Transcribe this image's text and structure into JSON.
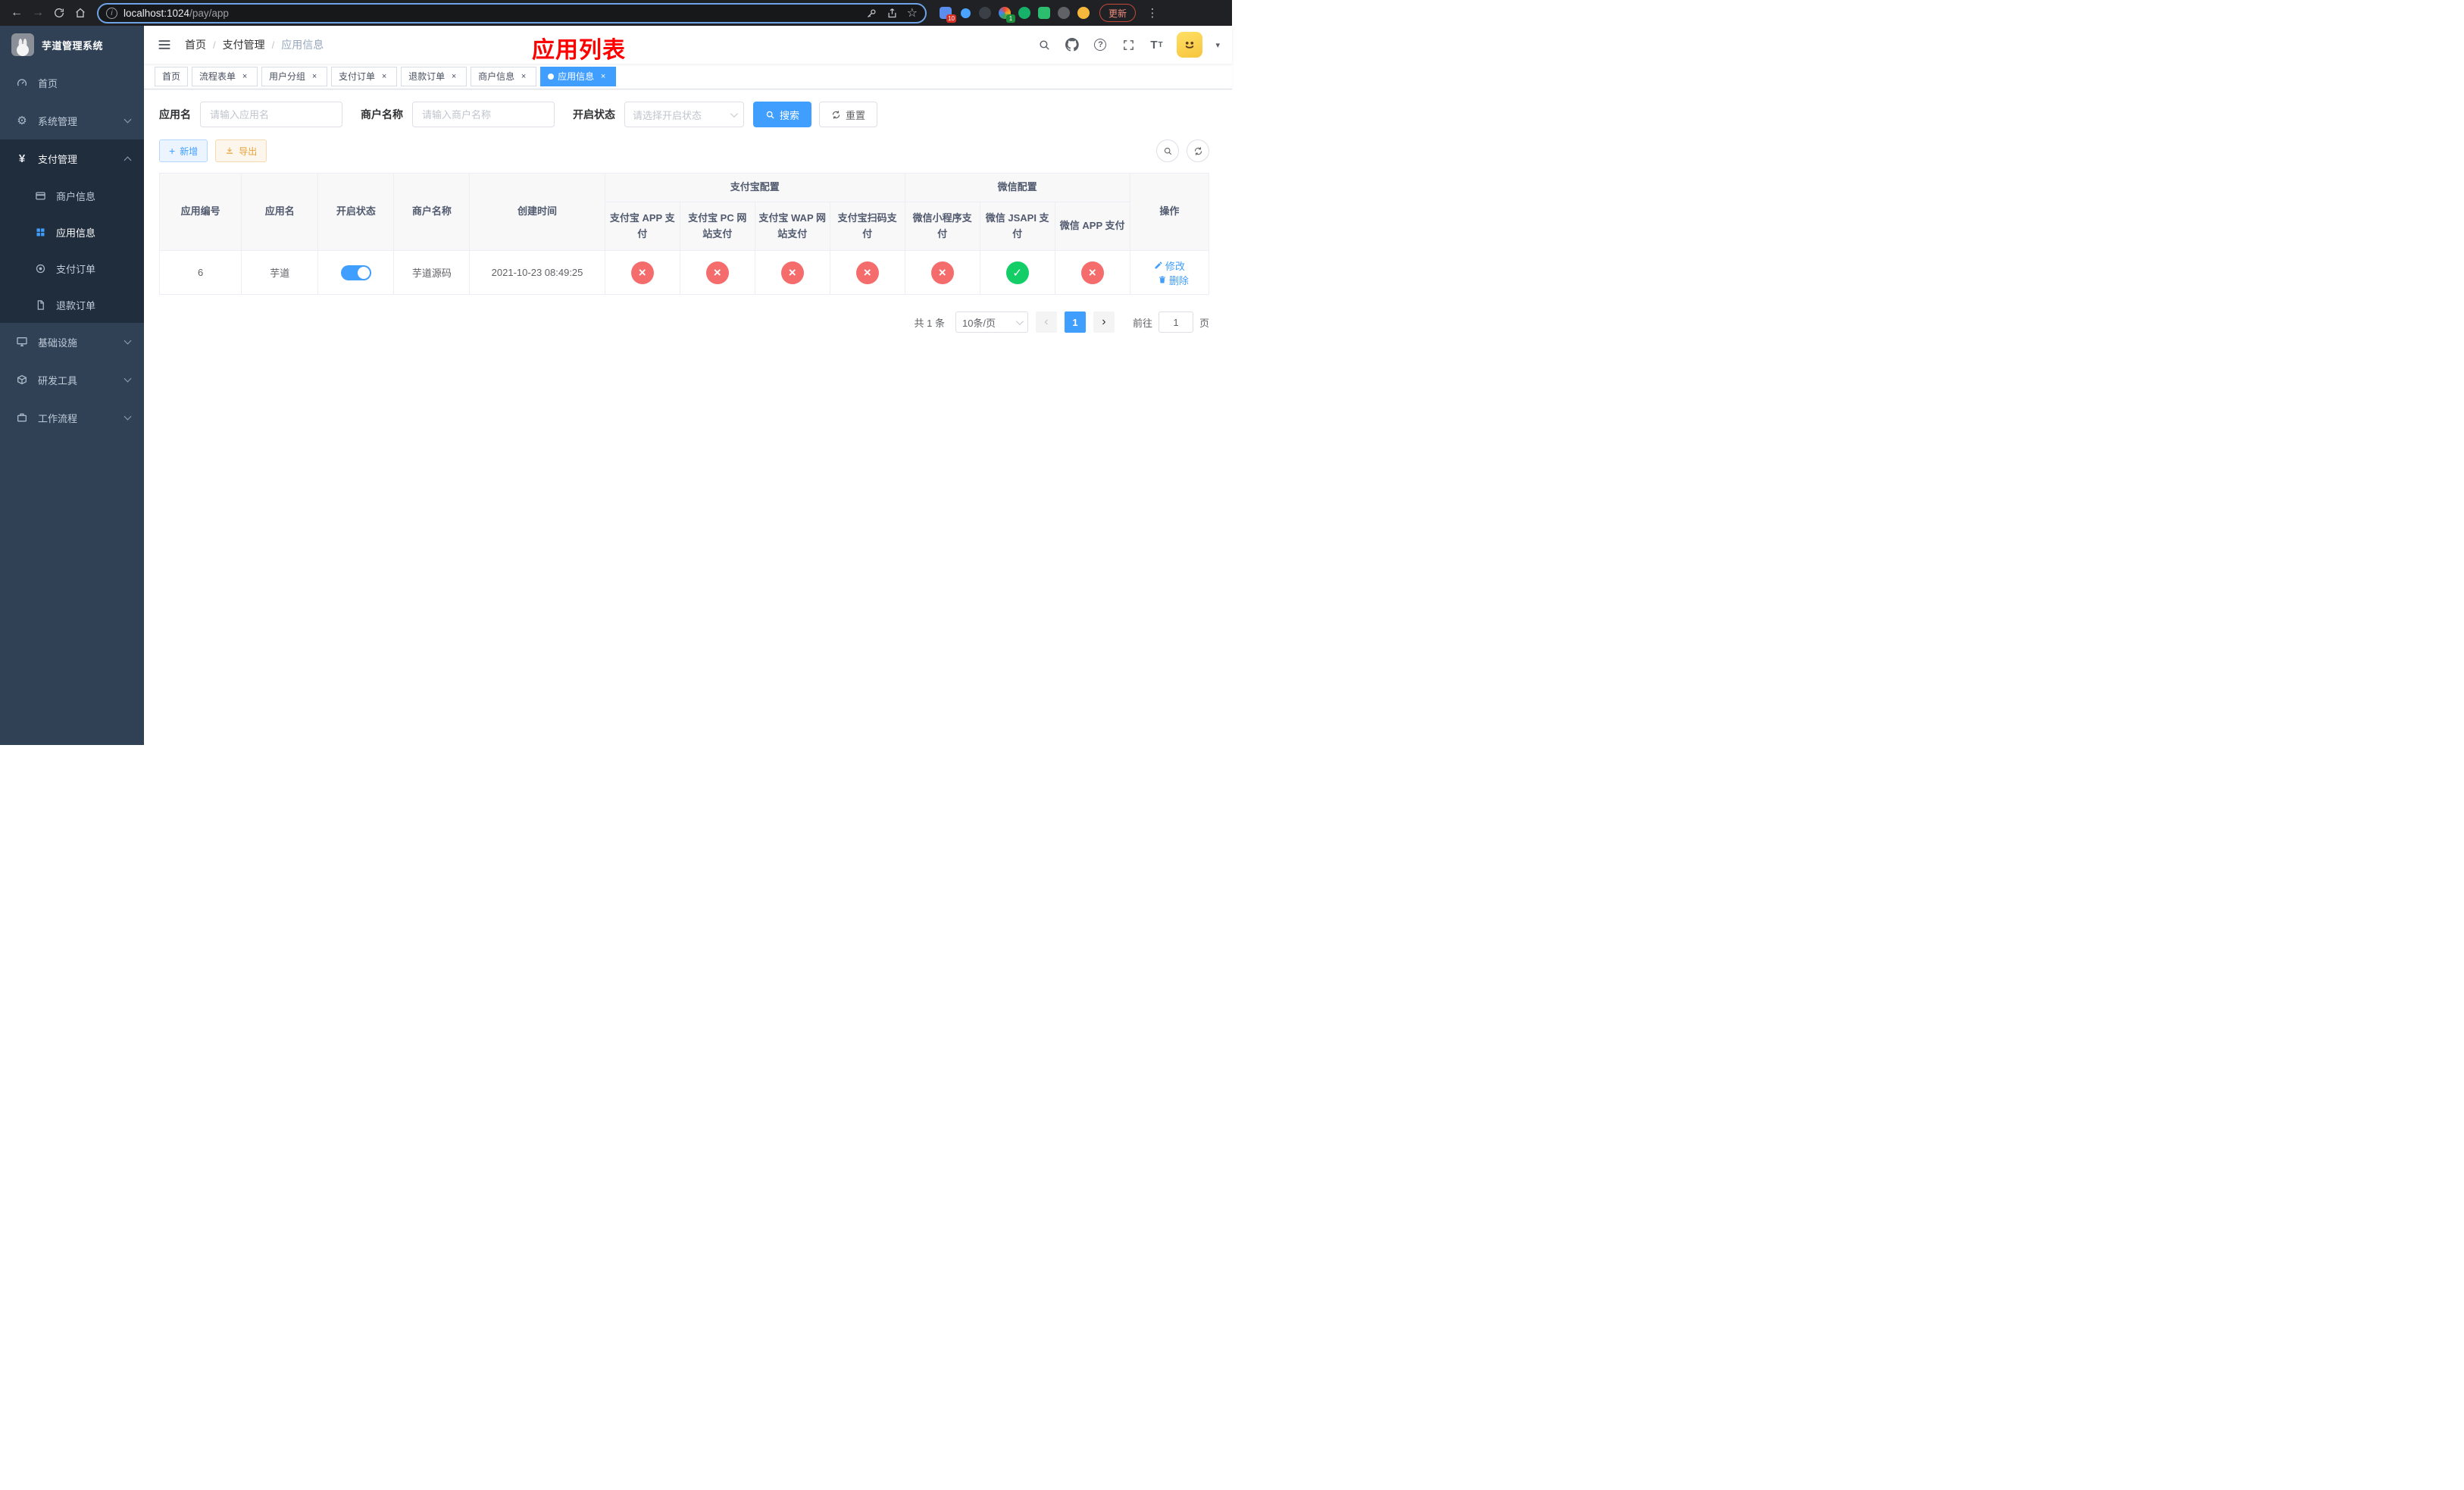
{
  "colors": {
    "accent": "#409eff",
    "title_red": "#ff0000",
    "status_no": "#f56c6c",
    "status_yes": "#13ce66",
    "export_orange": "#e6a23c",
    "sidebar_bg": "#304156",
    "sidebar_sub_bg": "#1f2d3d"
  },
  "browser": {
    "url_host": "localhost:1024",
    "url_path": "/pay/app",
    "update_label": "更新",
    "ext_badge_1": "10",
    "ext_badge_2": "1"
  },
  "sidebar": {
    "logo_title": "芋道管理系统",
    "items": [
      {
        "label": "首页"
      },
      {
        "label": "系统管理"
      },
      {
        "label": "支付管理"
      },
      {
        "label": "商户信息"
      },
      {
        "label": "应用信息"
      },
      {
        "label": "支付订单"
      },
      {
        "label": "退款订单"
      },
      {
        "label": "基础设施"
      },
      {
        "label": "研发工具"
      },
      {
        "label": "工作流程"
      }
    ]
  },
  "header": {
    "breadcrumb": [
      {
        "label": "首页"
      },
      {
        "label": "支付管理"
      },
      {
        "label": "应用信息"
      }
    ],
    "page_title": "应用列表"
  },
  "tabs": [
    {
      "label": "首页"
    },
    {
      "label": "流程表单"
    },
    {
      "label": "用户分组"
    },
    {
      "label": "支付订单"
    },
    {
      "label": "退款订单"
    },
    {
      "label": "商户信息"
    },
    {
      "label": "应用信息"
    }
  ],
  "filters": {
    "app_name_label": "应用名",
    "app_name_placeholder": "请输入应用名",
    "merchant_name_label": "商户名称",
    "merchant_name_placeholder": "请输入商户名称",
    "status_label": "开启状态",
    "status_placeholder": "请选择开启状态",
    "search_label": "搜索",
    "reset_label": "重置"
  },
  "toolbar": {
    "add_label": "新增",
    "export_label": "导出"
  },
  "table": {
    "alipay_group_label": "支付宝配置",
    "wechat_group_label": "微信配置",
    "col_app_id": "应用编号",
    "col_app_name": "应用名",
    "col_status": "开启状态",
    "col_merchant": "商户名称",
    "col_create_time": "创建时间",
    "col_alipay_app": "支付宝 APP 支付",
    "col_alipay_pc": "支付宝 PC 网站支付",
    "col_alipay_wap": "支付宝 WAP 网站支付",
    "col_alipay_qr": "支付宝扫码支付",
    "col_wechat_mini": "微信小程序支付",
    "col_wechat_jsapi": "微信 JSAPI 支付",
    "col_wechat_app": "微信 APP 支付",
    "col_actions": "操作",
    "rows": [
      {
        "app_id": "6",
        "app_name": "芋道",
        "status": "on",
        "merchant": "芋道源码",
        "create_time": "2021-10-23 08:49:25",
        "alipay_app": "no",
        "alipay_pc": "no",
        "alipay_wap": "no",
        "alipay_qr": "no",
        "wechat_mini": "no",
        "wechat_jsapi": "yes",
        "wechat_app": "no",
        "edit_label": "修改",
        "delete_label": "删除"
      }
    ]
  },
  "pagination": {
    "total_label": "共 1 条",
    "page_size_label": "10条/页",
    "page_number": "1",
    "goto_label": "前往",
    "goto_value": "1",
    "page_unit_label": "页"
  }
}
